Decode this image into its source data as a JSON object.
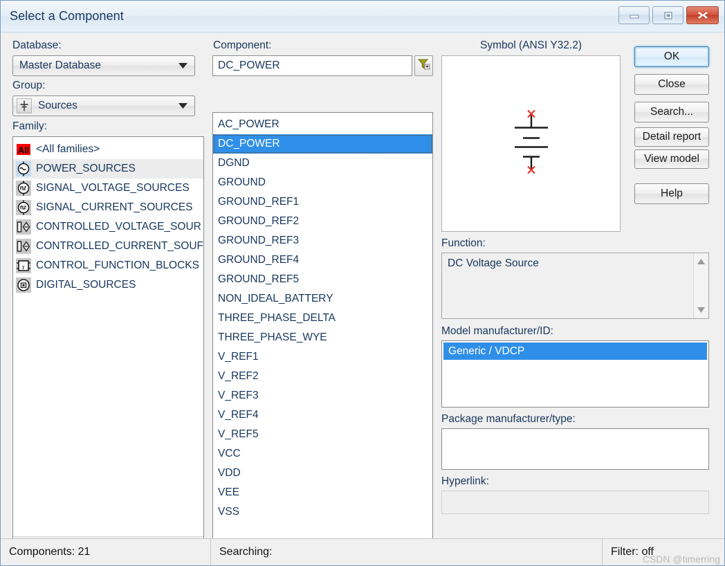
{
  "window": {
    "title": "Select a Component",
    "controls": [
      {
        "name": "minimize",
        "glyph": "minimize-icon"
      },
      {
        "name": "restore",
        "glyph": "restore-icon"
      },
      {
        "name": "close",
        "glyph": "close-icon"
      }
    ]
  },
  "database": {
    "label": "Database:",
    "value": "Master Database"
  },
  "group": {
    "label": "Group:",
    "value": "Sources",
    "icon": "source-symbol-icon"
  },
  "family": {
    "label": "Family:",
    "items": [
      {
        "label": "<All families>",
        "icon": "all-families-icon",
        "selected": false
      },
      {
        "label": "POWER_SOURCES",
        "icon": "power-sources-icon",
        "selected": true
      },
      {
        "label": "SIGNAL_VOLTAGE_SOURCES",
        "icon": "signal-voltage-sources-icon",
        "selected": false
      },
      {
        "label": "SIGNAL_CURRENT_SOURCES",
        "icon": "signal-current-sources-icon",
        "selected": false
      },
      {
        "label": "CONTROLLED_VOLTAGE_SOUR",
        "icon": "controlled-voltage-sources-icon",
        "selected": false
      },
      {
        "label": "CONTROLLED_CURRENT_SOUF",
        "icon": "controlled-current-sources-icon",
        "selected": false
      },
      {
        "label": "CONTROL_FUNCTION_BLOCKS",
        "icon": "control-function-blocks-icon",
        "selected": false
      },
      {
        "label": "DIGITAL_SOURCES",
        "icon": "digital-sources-icon",
        "selected": false
      }
    ]
  },
  "component": {
    "label": "Component:",
    "search_value": "DC_POWER",
    "filter_icon": "filter-funnel-icon",
    "items": [
      "AC_POWER",
      "DC_POWER",
      "DGND",
      "GROUND",
      "GROUND_REF1",
      "GROUND_REF2",
      "GROUND_REF3",
      "GROUND_REF4",
      "GROUND_REF5",
      "NON_IDEAL_BATTERY",
      "THREE_PHASE_DELTA",
      "THREE_PHASE_WYE",
      "V_REF1",
      "V_REF2",
      "V_REF3",
      "V_REF4",
      "V_REF5",
      "VCC",
      "VDD",
      "VEE",
      "VSS"
    ],
    "selected": "DC_POWER"
  },
  "symbol": {
    "label": "Symbol (ANSI Y32.2)",
    "graphic": "dc-battery-symbol"
  },
  "function": {
    "label": "Function:",
    "value": "DC Voltage Source"
  },
  "model_manufacturer": {
    "label": "Model manufacturer/ID:",
    "items": [
      "Generic / VDCP"
    ],
    "selected": "Generic / VDCP"
  },
  "package_manufacturer": {
    "label": "Package manufacturer/type:",
    "value": ""
  },
  "hyperlink": {
    "label": "Hyperlink:",
    "value": ""
  },
  "buttons": {
    "ok": "OK",
    "close": "Close",
    "search": "Search...",
    "detail_report": "Detail report",
    "view_model": "View model",
    "help": "Help"
  },
  "statusbar": {
    "components": "Components: 21",
    "searching": "Searching:",
    "filter": "Filter: off",
    "watermark": "CSDN @timerring"
  },
  "colors": {
    "selection_blue": "#2f8fe8",
    "title_text": "#17365d",
    "close_red": "#c3412b",
    "symbol_terminal_red": "#e8342a",
    "all_badge_red": "#ff0000"
  }
}
